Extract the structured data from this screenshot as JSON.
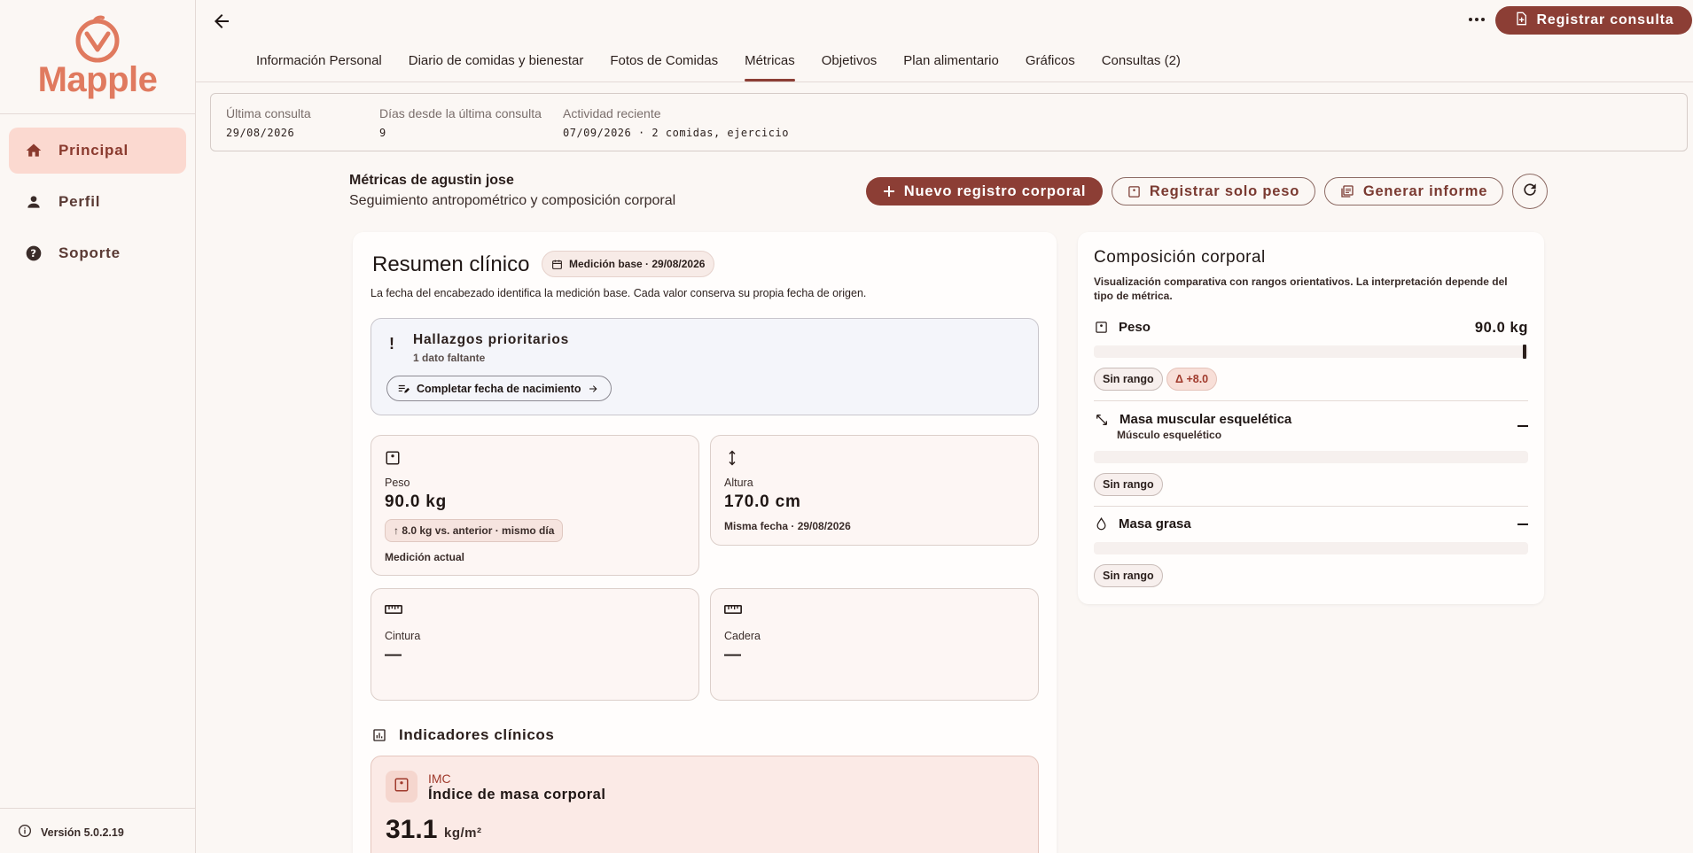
{
  "sidebar": {
    "logo_text": "Mapple",
    "items": [
      {
        "label": "Principal",
        "icon": "home-icon",
        "active": true
      },
      {
        "label": "Perfil",
        "icon": "person-icon",
        "active": false
      },
      {
        "label": "Soporte",
        "icon": "help-icon",
        "active": false
      }
    ],
    "version": "Versión 5.0.2.19"
  },
  "topbar": {
    "register_button": "Registrar consulta"
  },
  "tabs": [
    {
      "label": "Información Personal",
      "active": false
    },
    {
      "label": "Diario de comidas y bienestar",
      "active": false
    },
    {
      "label": "Fotos de Comidas",
      "active": false
    },
    {
      "label": "Métricas",
      "active": true
    },
    {
      "label": "Objetivos",
      "active": false
    },
    {
      "label": "Plan alimentario",
      "active": false
    },
    {
      "label": "Gráficos",
      "active": false
    },
    {
      "label": "Consultas (2)",
      "active": false
    }
  ],
  "info": {
    "last_label": "Última consulta",
    "last_value": "29/08/2026",
    "days_label": "Días desde la última consulta",
    "days_value": "9",
    "activity_label": "Actividad reciente",
    "activity_value": "07/09/2026 · 2 comidas, ejercicio"
  },
  "header": {
    "title": "Métricas de agustin jose",
    "subtitle": "Seguimiento antropométrico y composición corporal",
    "new_record": "Nuevo registro corporal",
    "weight_only": "Registrar solo peso",
    "report": "Generar informe"
  },
  "summary": {
    "title": "Resumen clínico",
    "base_chip": "Medición base · 29/08/2026",
    "note": "La fecha del encabezado identifica la medición base. Cada valor conserva su propia fecha de origen.",
    "findings_title": "Hallazgos prioritarios",
    "findings_sub": "1 dato faltante",
    "complete_button": "Completar fecha de nacimiento",
    "exclamation": "!"
  },
  "metrics": {
    "weight": {
      "label": "Peso",
      "value": "90.0 kg",
      "delta": "↑ 8.0 kg vs. anterior · mismo día",
      "note": "Medición actual"
    },
    "height": {
      "label": "Altura",
      "value": "170.0 cm",
      "note": "Misma fecha · 29/08/2026"
    },
    "waist": {
      "label": "Cintura",
      "value": "—"
    },
    "hip": {
      "label": "Cadera",
      "value": "—"
    }
  },
  "indicators": {
    "title": "Indicadores clínicos",
    "imc_abbr": "IMC",
    "imc_name": "Índice de masa corporal",
    "imc_value": "31.1",
    "imc_unit": "kg/m²"
  },
  "composition": {
    "title": "Composición corporal",
    "desc": "Visualización comparativa con rangos orientativos. La interpretación depende del tipo de métrica.",
    "weight_label": "Peso",
    "weight_value": "90.0 kg",
    "no_range": "Sin rango",
    "weight_delta": "Δ +8.0",
    "muscle_label": "Masa muscular esquelética",
    "muscle_sub": "Músculo esquelético",
    "fat_label": "Masa grasa"
  },
  "colors": {
    "primary": "#8c3e35",
    "accent": "#e07a5f",
    "active_nav": "#fbd9d0"
  }
}
